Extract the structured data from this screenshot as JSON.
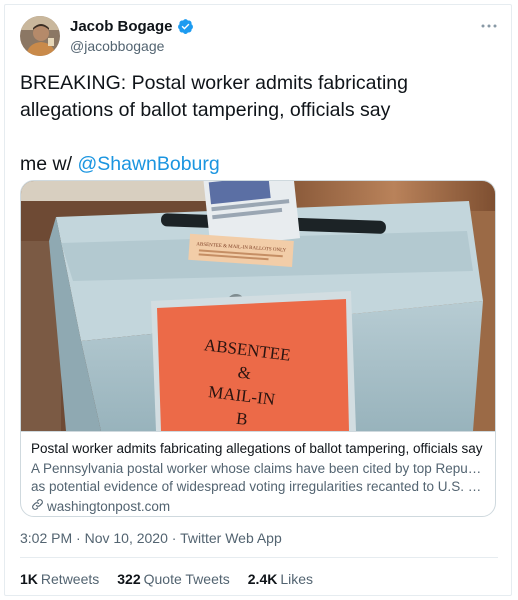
{
  "tweet": {
    "author": {
      "name": "Jacob Bogage",
      "handle": "@jacobbogage"
    },
    "text_line1": "BREAKING: Postal worker admits fabricating allegations of ballot tampering, officials say",
    "text_prefix": "me w/ ",
    "mention": "@ShawnBoburg",
    "timestamp": "3:02 PM · Nov 10, 2020",
    "separator": " · ",
    "source": "Twitter Web App"
  },
  "card": {
    "title": "Postal worker admits fabricating allegations of ballot tampering, officials say",
    "desc_line1": "A Pennsylvania postal worker whose claims have been cited by top Republicans",
    "desc_line2": "as potential evidence of widespread voting irregularities recanted to U.S. Post...",
    "domain": "washingtonpost.com",
    "image": {
      "sign_line1": "ABSENTEE",
      "sign_line2": "&",
      "sign_line3": "MAIL-IN",
      "sign_line4": "B",
      "label_text": "ABSENTEE & MAIL-IN BALLOTS ONLY"
    }
  },
  "stats": {
    "retweets_count": "1K",
    "retweets_label": "Retweets",
    "quotes_count": "322",
    "quotes_label": "Quote Tweets",
    "likes_count": "2.4K",
    "likes_label": "Likes"
  },
  "colors": {
    "link": "#1b95e0",
    "verified": "#1d9bf0",
    "box": "#a9c3cc",
    "sign": "#ec6a48"
  },
  "icons": {
    "verified": "verified-badge-icon",
    "more": "more-icon",
    "link": "link-icon"
  }
}
